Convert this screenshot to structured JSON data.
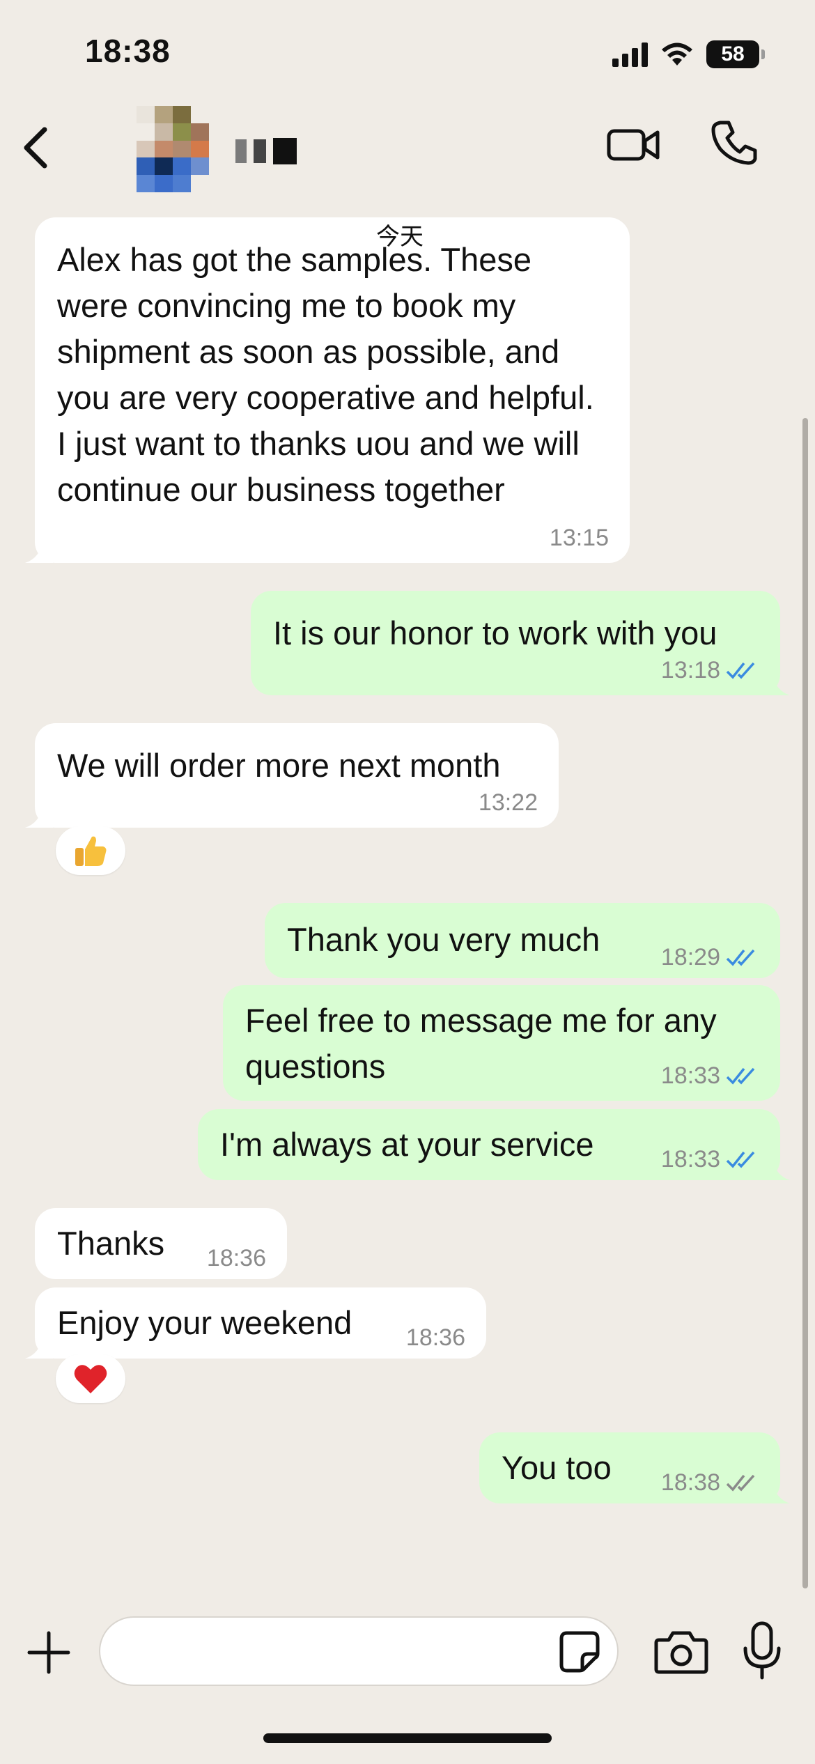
{
  "status_bar": {
    "time": "18:38",
    "battery": "58"
  },
  "header": {
    "back_icon": "chevron-left-icon",
    "video_icon": "video-camera-icon",
    "phone_icon": "phone-icon"
  },
  "date_label": "今天",
  "messages": [
    {
      "direction": "incoming",
      "text": "Alex has got the samples. These were convincing me to book my shipment as soon as possible, and you are very cooperative and helpful. I just want to thanks uou and we will continue our business together",
      "time": "13:15"
    },
    {
      "direction": "outgoing",
      "text": "It is our honor to work with you",
      "time": "13:18",
      "status": "read"
    },
    {
      "direction": "incoming",
      "text": "We will order more next month",
      "time": "13:22",
      "reaction": "👍"
    },
    {
      "direction": "outgoing",
      "text": "Thank you very much",
      "time": "18:29",
      "status": "read"
    },
    {
      "direction": "outgoing",
      "text": "Feel free to message me for any questions",
      "time": "18:33",
      "status": "read"
    },
    {
      "direction": "outgoing",
      "text": "I'm always at your service",
      "time": "18:33",
      "status": "read"
    },
    {
      "direction": "incoming",
      "text": "Thanks",
      "time": "18:36"
    },
    {
      "direction": "incoming",
      "text": "Enjoy your weekend",
      "time": "18:36",
      "reaction": "❤️"
    },
    {
      "direction": "outgoing",
      "text": "You too",
      "time": "18:38",
      "status": "delivered"
    }
  ],
  "input_bar": {
    "placeholder": "",
    "plus_icon": "plus-icon",
    "sticker_icon": "sticker-icon",
    "camera_icon": "camera-icon",
    "mic_icon": "microphone-icon"
  },
  "colors": {
    "background": "#f0ece6",
    "incoming": "#ffffff",
    "outgoing": "#d9fdd3",
    "read_ticks": "#3a8be0",
    "delivered_ticks": "#8a8a8a"
  }
}
